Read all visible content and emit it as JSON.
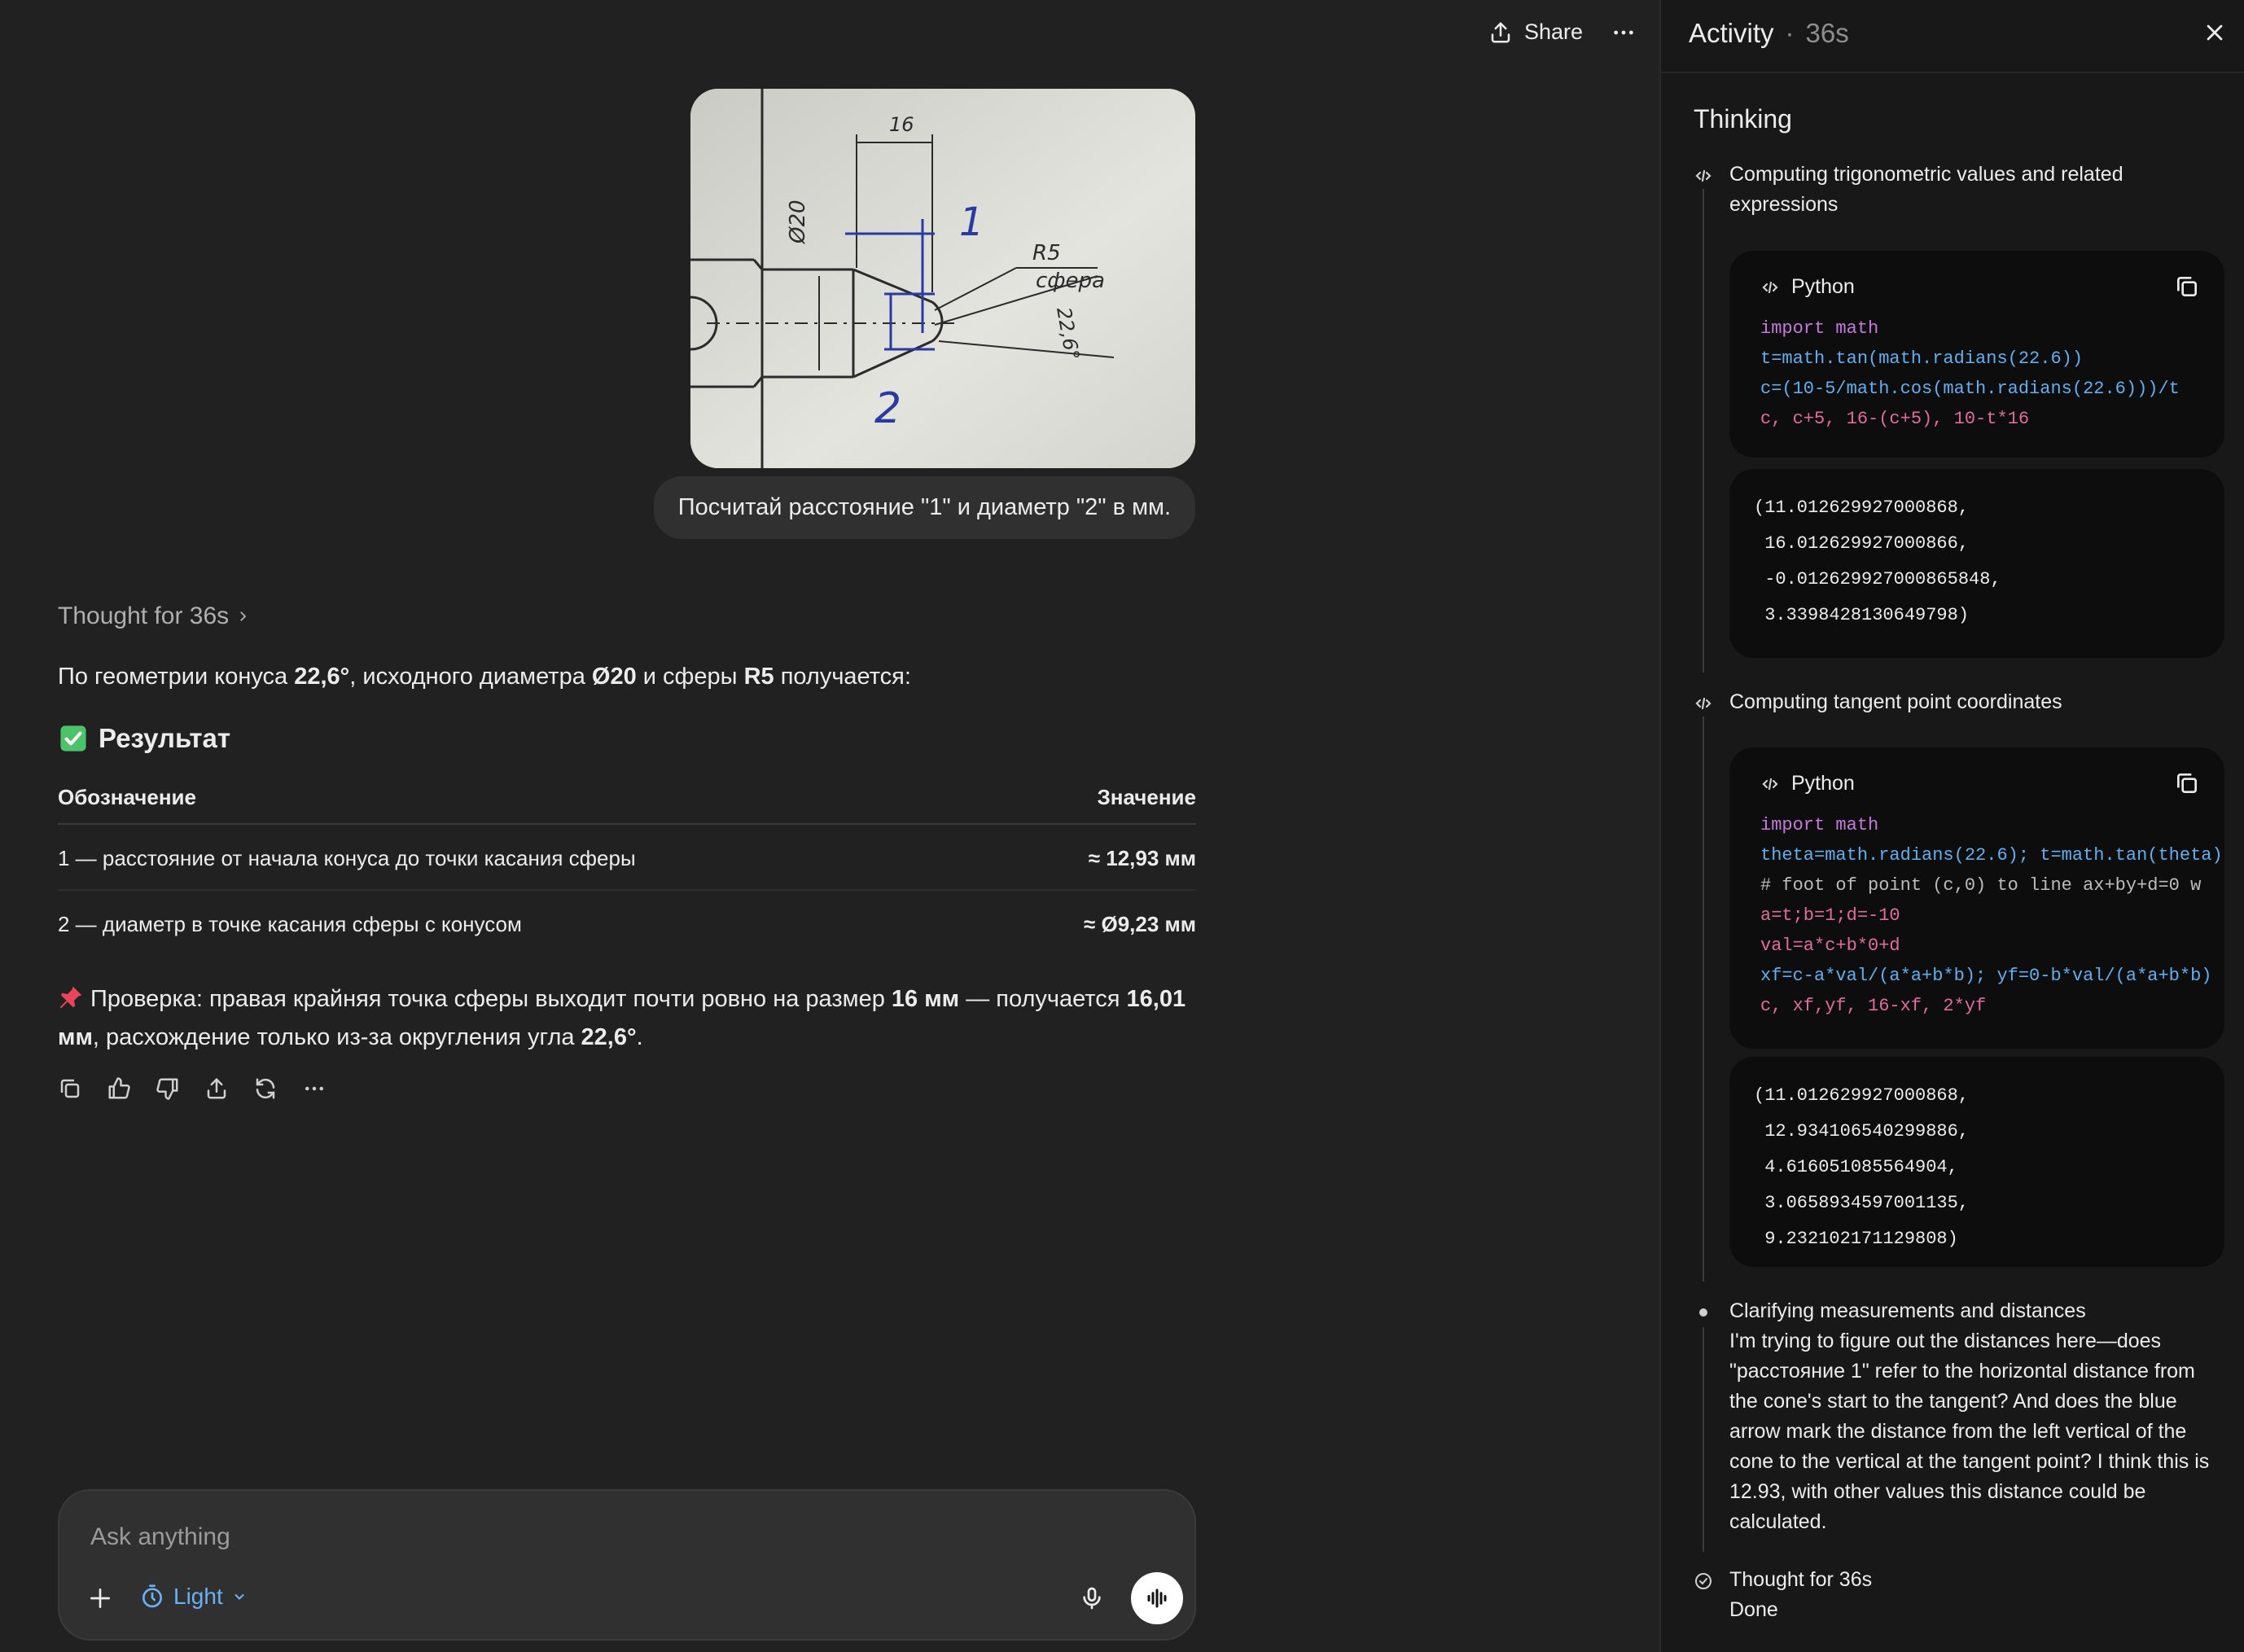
{
  "header": {
    "share_label": "Share"
  },
  "chat": {
    "user_message": "Посчитай расстояние \"1\" и диаметр \"2\" в мм.",
    "image_labels": {
      "dim16": "16",
      "d20": "Ø20",
      "r5": "R5",
      "sphere": "сфера",
      "angle": "22,6°",
      "mark1": "1",
      "mark2": "2"
    },
    "thought_label": "Thought for 36s",
    "intro_parts": [
      "По геометрии конуса ",
      "22,6°",
      ", исходного диаметра ",
      "Ø20",
      " и сферы ",
      "R5",
      " получается:"
    ],
    "result_heading": "Результат",
    "table": {
      "headers": [
        "Обозначение",
        "Значение"
      ],
      "rows": [
        {
          "label": "1 — расстояние от начала конуса до точки касания сферы",
          "value": "≈ 12,93 мм"
        },
        {
          "label": "2 — диаметр в точке касания сферы с конусом",
          "value": "≈ Ø9,23 мм"
        }
      ]
    },
    "check_parts": [
      "Проверка: правая крайняя точка сферы выходит почти ровно на размер ",
      "16 мм",
      " — получается ",
      "16,01 мм",
      ", расхождение только из-за округления угла ",
      "22,6°",
      "."
    ]
  },
  "composer": {
    "placeholder": "Ask anything",
    "mode_label": "Light"
  },
  "sidebar": {
    "title": "Activity",
    "duration": "36s",
    "thinking_heading": "Thinking",
    "step1": "Computing trigonometric values and related expressions",
    "code_lang": "Python",
    "code1": [
      "import math",
      "t=math.tan(math.radians(22.6))",
      "c=(10-5/math.cos(math.radians(22.6)))/t",
      "c, c+5, 16-(c+5), 10-t*16"
    ],
    "output1": [
      "(11.012629927000868,",
      " 16.012629927000866,",
      " -0.012629927000865848,",
      " 3.3398428130649798)"
    ],
    "step2": "Computing tangent point coordinates",
    "code2": [
      "import math",
      "theta=math.radians(22.6); t=math.tan(theta)",
      "# foot of point (c,0) to line ax+by+d=0 w",
      "a=t;b=1;d=-10",
      "val=a*c+b*0+d",
      "xf=c-a*val/(a*a+b*b); yf=0-b*val/(a*a+b*b)",
      "c, xf,yf, 16-xf, 2*yf"
    ],
    "output2": [
      "(11.012629927000868,",
      " 12.934106540299886,",
      " 4.616051085564904,",
      " 3.0658934597001135,",
      " 9.232102171129808)"
    ],
    "step3_title": "Clarifying measurements and distances",
    "step3_body": "I'm trying to figure out the distances here—does \"расстояние 1\" refer to the horizontal distance from the cone's start to the tangent? And does the blue arrow mark the distance from the left vertical of the cone to the vertical at the tangent point? I think this is 12.93, with other values this distance could be calculated.",
    "step4_title": "Thought for 36s",
    "step4_sub": "Done"
  },
  "colors": {
    "background": "#212121",
    "sidebar": "#181818",
    "bubble": "#303030",
    "accent_blue": "#6ab0f3"
  }
}
